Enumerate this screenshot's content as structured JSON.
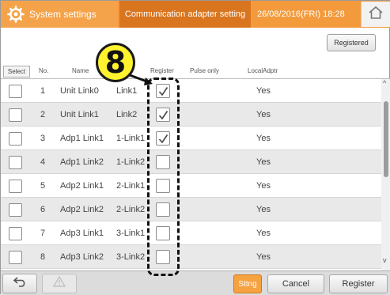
{
  "header": {
    "title": "System settings",
    "tab": "Communication adapter setting",
    "datetime": "26/08/2016(FRI) 18:28"
  },
  "toolbar": {
    "registered_label": "Registered"
  },
  "columns": {
    "select": "Select",
    "no": "No.",
    "name": "Name",
    "register": "Register",
    "pulse_only": "Pulse only",
    "local_adptr": "LocalAdptr"
  },
  "rows": [
    {
      "no": "1",
      "name": "Unit Link0",
      "link": "Link1",
      "registered": true,
      "local": "Yes"
    },
    {
      "no": "2",
      "name": "Unit Link1",
      "link": "Link2",
      "registered": true,
      "local": "Yes"
    },
    {
      "no": "3",
      "name": "Adp1 Link1",
      "link": "1-Link1",
      "registered": true,
      "local": "Yes"
    },
    {
      "no": "4",
      "name": "Adp1 Link2",
      "link": "1-Link2",
      "registered": false,
      "local": "Yes"
    },
    {
      "no": "5",
      "name": "Adp2 Link1",
      "link": "2-Link1",
      "registered": false,
      "local": "Yes"
    },
    {
      "no": "6",
      "name": "Adp2 Link2",
      "link": "2-Link2",
      "registered": false,
      "local": "Yes"
    },
    {
      "no": "7",
      "name": "Adp3 Link1",
      "link": "3-Link1",
      "registered": false,
      "local": "Yes"
    },
    {
      "no": "8",
      "name": "Adp3 Link2",
      "link": "3-Link2",
      "registered": false,
      "local": "Yes"
    }
  ],
  "footer": {
    "sttng_label": "Sttng",
    "cancel_label": "Cancel",
    "register_label": "Register"
  },
  "callout": {
    "number": "8"
  },
  "icons": {
    "gear": "gear-icon",
    "home": "home-icon",
    "back": "back-arrow-icon",
    "warning": "warning-icon",
    "check": "check-icon"
  },
  "colors": {
    "header_orange": "#f39a3c",
    "tab_dark_orange": "#d9751f",
    "sttng_orange": "#f7a240",
    "callout_yellow": "#fff22f"
  }
}
